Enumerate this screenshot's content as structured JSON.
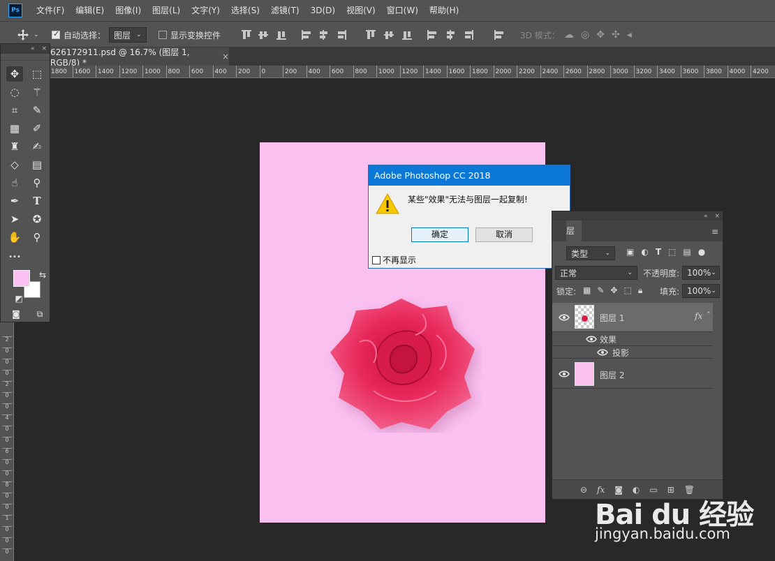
{
  "app": {
    "logo": "Ps"
  },
  "menu": [
    "文件(F)",
    "编辑(E)",
    "图像(I)",
    "图层(L)",
    "文字(Y)",
    "选择(S)",
    "滤镜(T)",
    "3D(D)",
    "视图(V)",
    "窗口(W)",
    "帮助(H)"
  ],
  "options": {
    "auto_select_label": "自动选择：",
    "auto_select_checked": true,
    "auto_select_target": "图层",
    "show_transform_label": "显示变换控件",
    "show_transform_checked": false,
    "mode_3d_label": "3D 模式："
  },
  "document": {
    "tab_title": "626172911.psd @ 16.7% (图层 1, RGB/8) *",
    "close": "×",
    "background_color": "#f9c0f0"
  },
  "ruler": {
    "h_ticks": [
      "1800",
      "1600",
      "1400",
      "1200",
      "1000",
      "800",
      "600",
      "400",
      "200",
      "0",
      "200",
      "400",
      "600",
      "800",
      "1000",
      "1200",
      "1400",
      "1600",
      "1800",
      "2000",
      "2200",
      "2400",
      "2600",
      "2800",
      "3000",
      "3200",
      "3400",
      "3600",
      "3800",
      "4000",
      "4200"
    ],
    "v_ticks": [
      "2",
      "0",
      "0",
      "0",
      "2",
      "0",
      "0",
      "4",
      "0",
      "0",
      "6",
      "0",
      "0",
      "8",
      "0",
      "0",
      "1",
      "0",
      "0",
      "0"
    ]
  },
  "toolbox": {
    "collapse": "«",
    "close": "×",
    "more_label": "•••",
    "foreground_color": "#f9c0f0",
    "background_color": "#ffffff"
  },
  "dialog": {
    "title": "Adobe Photoshop CC 2018",
    "message": "某些\"效果\"无法与图层一起复制!",
    "ok": "确定",
    "cancel": "取消",
    "dont_show": "不再显示"
  },
  "layers_panel": {
    "collapse": "«",
    "close": "×",
    "tab_fragment": "层",
    "menu_icon": "≡",
    "filter_kind": "类型",
    "blend_mode": "正常",
    "opacity_label": "不透明度:",
    "opacity": "100%",
    "lock_label": "锁定:",
    "fill_label": "填充:",
    "fill": "100%",
    "layers": [
      {
        "name": "图层 1",
        "fx": "fx",
        "effects_label": "效果",
        "effect": "投影",
        "selected": true
      },
      {
        "name": "图层 2",
        "thumb_color": "#f9c0f0",
        "selected": false
      }
    ],
    "footer_fx": "fx"
  },
  "watermark": {
    "logo": "Bai du 经验",
    "url": "jingyan.baidu.com"
  }
}
